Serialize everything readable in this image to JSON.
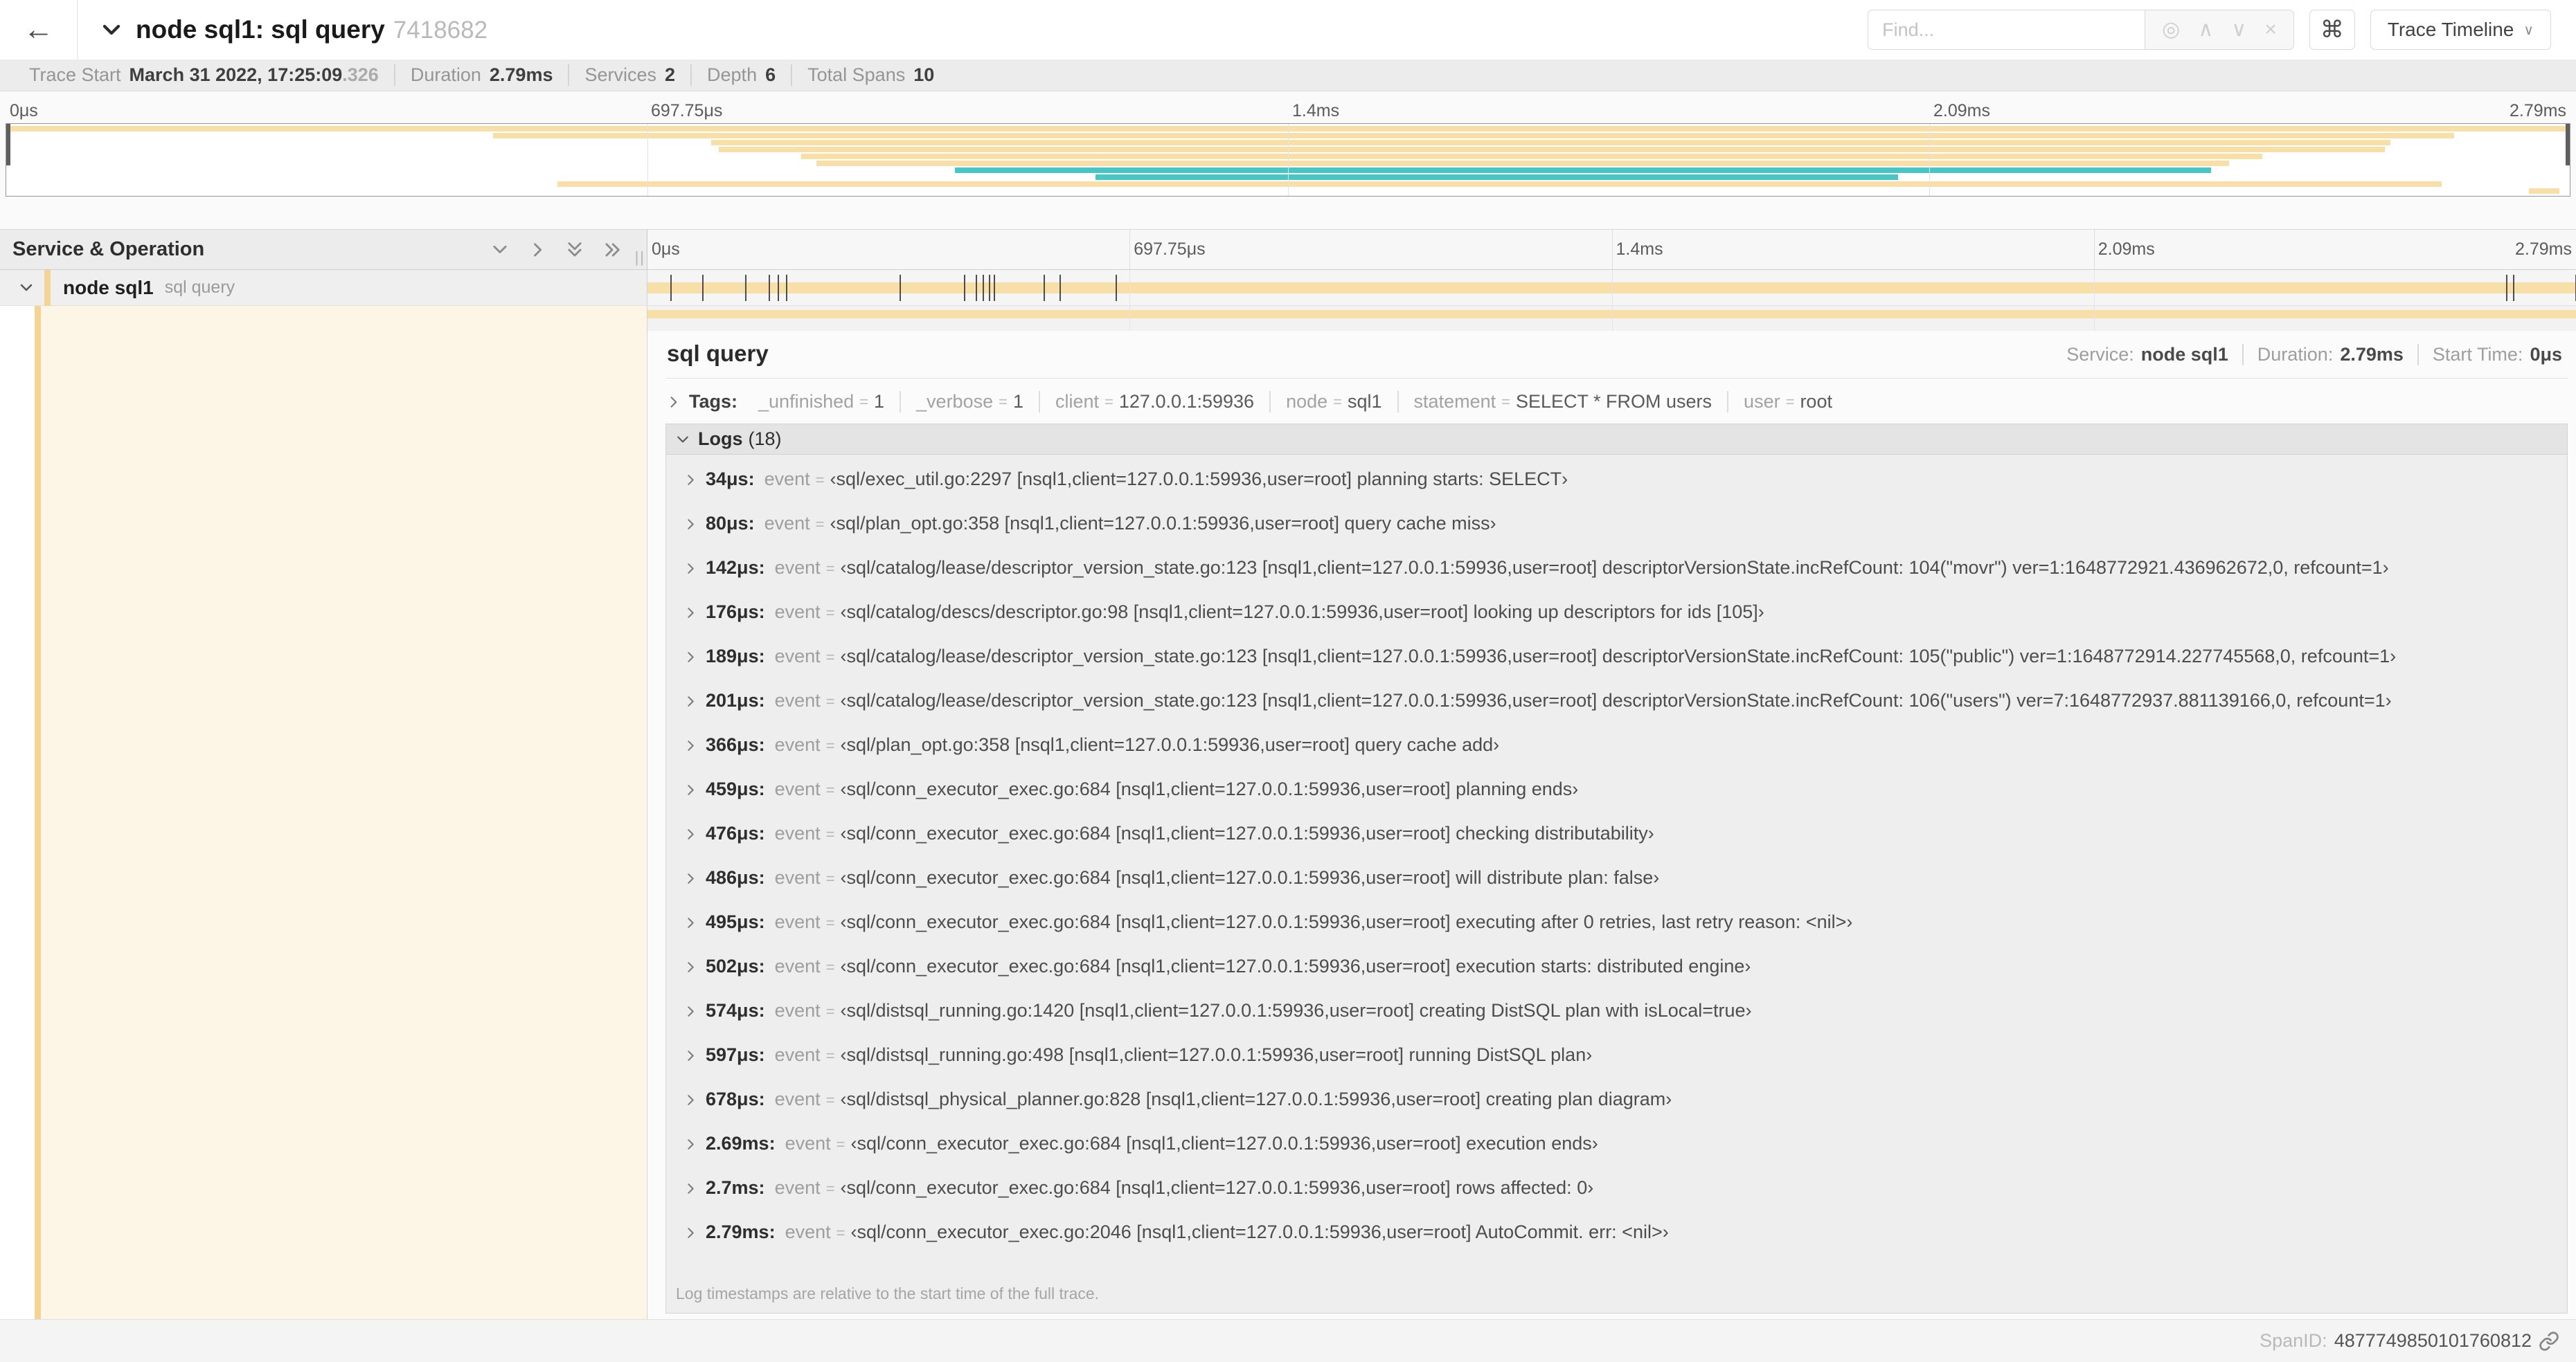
{
  "header": {
    "back_icon": "←",
    "title": "node sql1: sql query",
    "trace_id": "7418682",
    "find_placeholder": "Find...",
    "find_icons": [
      "crosshair-icon",
      "chevron-up-icon",
      "chevron-down-icon",
      "close-icon"
    ],
    "find_icon_glyphs": {
      "crosshair": "◎",
      "up": "∧",
      "down": "∨",
      "close": "×"
    },
    "shortcuts_button": "⌘",
    "view_dropdown_label": "Trace Timeline",
    "view_dropdown_caret": "∨"
  },
  "summary": {
    "items": [
      {
        "label": "Trace Start",
        "value": "March 31 2022, 17:25:09",
        "suffix": ".326"
      },
      {
        "label": "Duration",
        "value": "2.79ms",
        "suffix": ""
      },
      {
        "label": "Services",
        "value": "2",
        "suffix": ""
      },
      {
        "label": "Depth",
        "value": "6",
        "suffix": ""
      },
      {
        "label": "Total Spans",
        "value": "10",
        "suffix": ""
      }
    ]
  },
  "timeline": {
    "duration_us": 2790,
    "ticks": [
      "0μs",
      "697.75μs",
      "1.4ms",
      "2.09ms",
      "2.79ms"
    ],
    "tick_positions_pct": [
      0,
      25,
      50,
      75,
      100
    ],
    "colors": {
      "tan": "#F7DFA7",
      "teal": "#48C6C6",
      "stripe": "#F4D494"
    },
    "minimap_spans": [
      {
        "start": 0,
        "end": 100,
        "color": "tan"
      },
      {
        "start": 19,
        "end": 95.5,
        "color": "tan"
      },
      {
        "start": 27.5,
        "end": 93,
        "color": "tan"
      },
      {
        "start": 27.8,
        "end": 92.8,
        "color": "tan"
      },
      {
        "start": 31,
        "end": 88,
        "color": "tan"
      },
      {
        "start": 31.6,
        "end": 86.7,
        "color": "tan"
      },
      {
        "start": 37,
        "end": 86,
        "color": "teal"
      },
      {
        "start": 42.5,
        "end": 73.8,
        "color": "teal"
      },
      {
        "start": 21.5,
        "end": 95,
        "color": "tan"
      },
      {
        "start": 98.4,
        "end": 99.6,
        "color": "tan"
      }
    ]
  },
  "span_table": {
    "header_label": "Service & Operation",
    "header_icons": [
      "collapse-one-icon",
      "expand-one-icon",
      "collapse-all-icon",
      "expand-all-icon"
    ],
    "resizer_glyph": "||",
    "row": {
      "service": "node sql1",
      "operation": "sql query"
    }
  },
  "detail": {
    "title": "sql query",
    "meta": [
      {
        "label": "Service:",
        "value": "node sql1"
      },
      {
        "label": "Duration:",
        "value": "2.79ms"
      },
      {
        "label": "Start Time:",
        "value": "0μs"
      }
    ],
    "tags_label": "Tags:",
    "tags": [
      {
        "key": "_unfinished",
        "value": "1"
      },
      {
        "key": "_verbose",
        "value": "1"
      },
      {
        "key": "client",
        "value": "127.0.0.1:59936"
      },
      {
        "key": "node",
        "value": "sql1"
      },
      {
        "key": "statement",
        "value": "SELECT * FROM users"
      },
      {
        "key": "user",
        "value": "root"
      }
    ],
    "logs_label": "Logs",
    "logs_count": "(18)",
    "logs": [
      {
        "time": "34μs:",
        "t_us": 34,
        "field": "event",
        "value": "‹sql/exec_util.go:2297 [nsql1,client=127.0.0.1:59936,user=root] planning starts: SELECT›"
      },
      {
        "time": "80μs:",
        "t_us": 80,
        "field": "event",
        "value": "‹sql/plan_opt.go:358 [nsql1,client=127.0.0.1:59936,user=root] query cache miss›"
      },
      {
        "time": "142μs:",
        "t_us": 142,
        "field": "event",
        "value": "‹sql/catalog/lease/descriptor_version_state.go:123 [nsql1,client=127.0.0.1:59936,user=root] descriptorVersionState.incRefCount: 104(\"movr\") ver=1:1648772921.436962672,0, refcount=1›"
      },
      {
        "time": "176μs:",
        "t_us": 176,
        "field": "event",
        "value": "‹sql/catalog/descs/descriptor.go:98 [nsql1,client=127.0.0.1:59936,user=root] looking up descriptors for ids [105]›"
      },
      {
        "time": "189μs:",
        "t_us": 189,
        "field": "event",
        "value": "‹sql/catalog/lease/descriptor_version_state.go:123 [nsql1,client=127.0.0.1:59936,user=root] descriptorVersionState.incRefCount: 105(\"public\") ver=1:1648772914.227745568,0, refcount=1›"
      },
      {
        "time": "201μs:",
        "t_us": 201,
        "field": "event",
        "value": "‹sql/catalog/lease/descriptor_version_state.go:123 [nsql1,client=127.0.0.1:59936,user=root] descriptorVersionState.incRefCount: 106(\"users\") ver=7:1648772937.881139166,0, refcount=1›"
      },
      {
        "time": "366μs:",
        "t_us": 366,
        "field": "event",
        "value": "‹sql/plan_opt.go:358 [nsql1,client=127.0.0.1:59936,user=root] query cache add›"
      },
      {
        "time": "459μs:",
        "t_us": 459,
        "field": "event",
        "value": "‹sql/conn_executor_exec.go:684 [nsql1,client=127.0.0.1:59936,user=root] planning ends›"
      },
      {
        "time": "476μs:",
        "t_us": 476,
        "field": "event",
        "value": "‹sql/conn_executor_exec.go:684 [nsql1,client=127.0.0.1:59936,user=root] checking distributability›"
      },
      {
        "time": "486μs:",
        "t_us": 486,
        "field": "event",
        "value": "‹sql/conn_executor_exec.go:684 [nsql1,client=127.0.0.1:59936,user=root] will distribute plan: false›"
      },
      {
        "time": "495μs:",
        "t_us": 495,
        "field": "event",
        "value": "‹sql/conn_executor_exec.go:684 [nsql1,client=127.0.0.1:59936,user=root] executing after 0 retries, last retry reason: <nil>›"
      },
      {
        "time": "502μs:",
        "t_us": 502,
        "field": "event",
        "value": "‹sql/conn_executor_exec.go:684 [nsql1,client=127.0.0.1:59936,user=root] execution starts: distributed engine›"
      },
      {
        "time": "574μs:",
        "t_us": 574,
        "field": "event",
        "value": "‹sql/distsql_running.go:1420 [nsql1,client=127.0.0.1:59936,user=root] creating DistSQL plan with isLocal=true›"
      },
      {
        "time": "597μs:",
        "t_us": 597,
        "field": "event",
        "value": "‹sql/distsql_running.go:498 [nsql1,client=127.0.0.1:59936,user=root] running DistSQL plan›"
      },
      {
        "time": "678μs:",
        "t_us": 678,
        "field": "event",
        "value": "‹sql/distsql_physical_planner.go:828 [nsql1,client=127.0.0.1:59936,user=root] creating plan diagram›"
      },
      {
        "time": "2.69ms:",
        "t_us": 2690,
        "field": "event",
        "value": "‹sql/conn_executor_exec.go:684 [nsql1,client=127.0.0.1:59936,user=root] execution ends›"
      },
      {
        "time": "2.7ms:",
        "t_us": 2700,
        "field": "event",
        "value": "‹sql/conn_executor_exec.go:684 [nsql1,client=127.0.0.1:59936,user=root] rows affected: 0›"
      },
      {
        "time": "2.79ms:",
        "t_us": 2790,
        "field": "event",
        "value": "‹sql/conn_executor_exec.go:2046 [nsql1,client=127.0.0.1:59936,user=root] AutoCommit. err: <nil>›"
      }
    ],
    "logs_note": "Log timestamps are relative to the start time of the full trace.",
    "span_id_label": "SpanID:",
    "span_id": "4877749850101760812"
  }
}
